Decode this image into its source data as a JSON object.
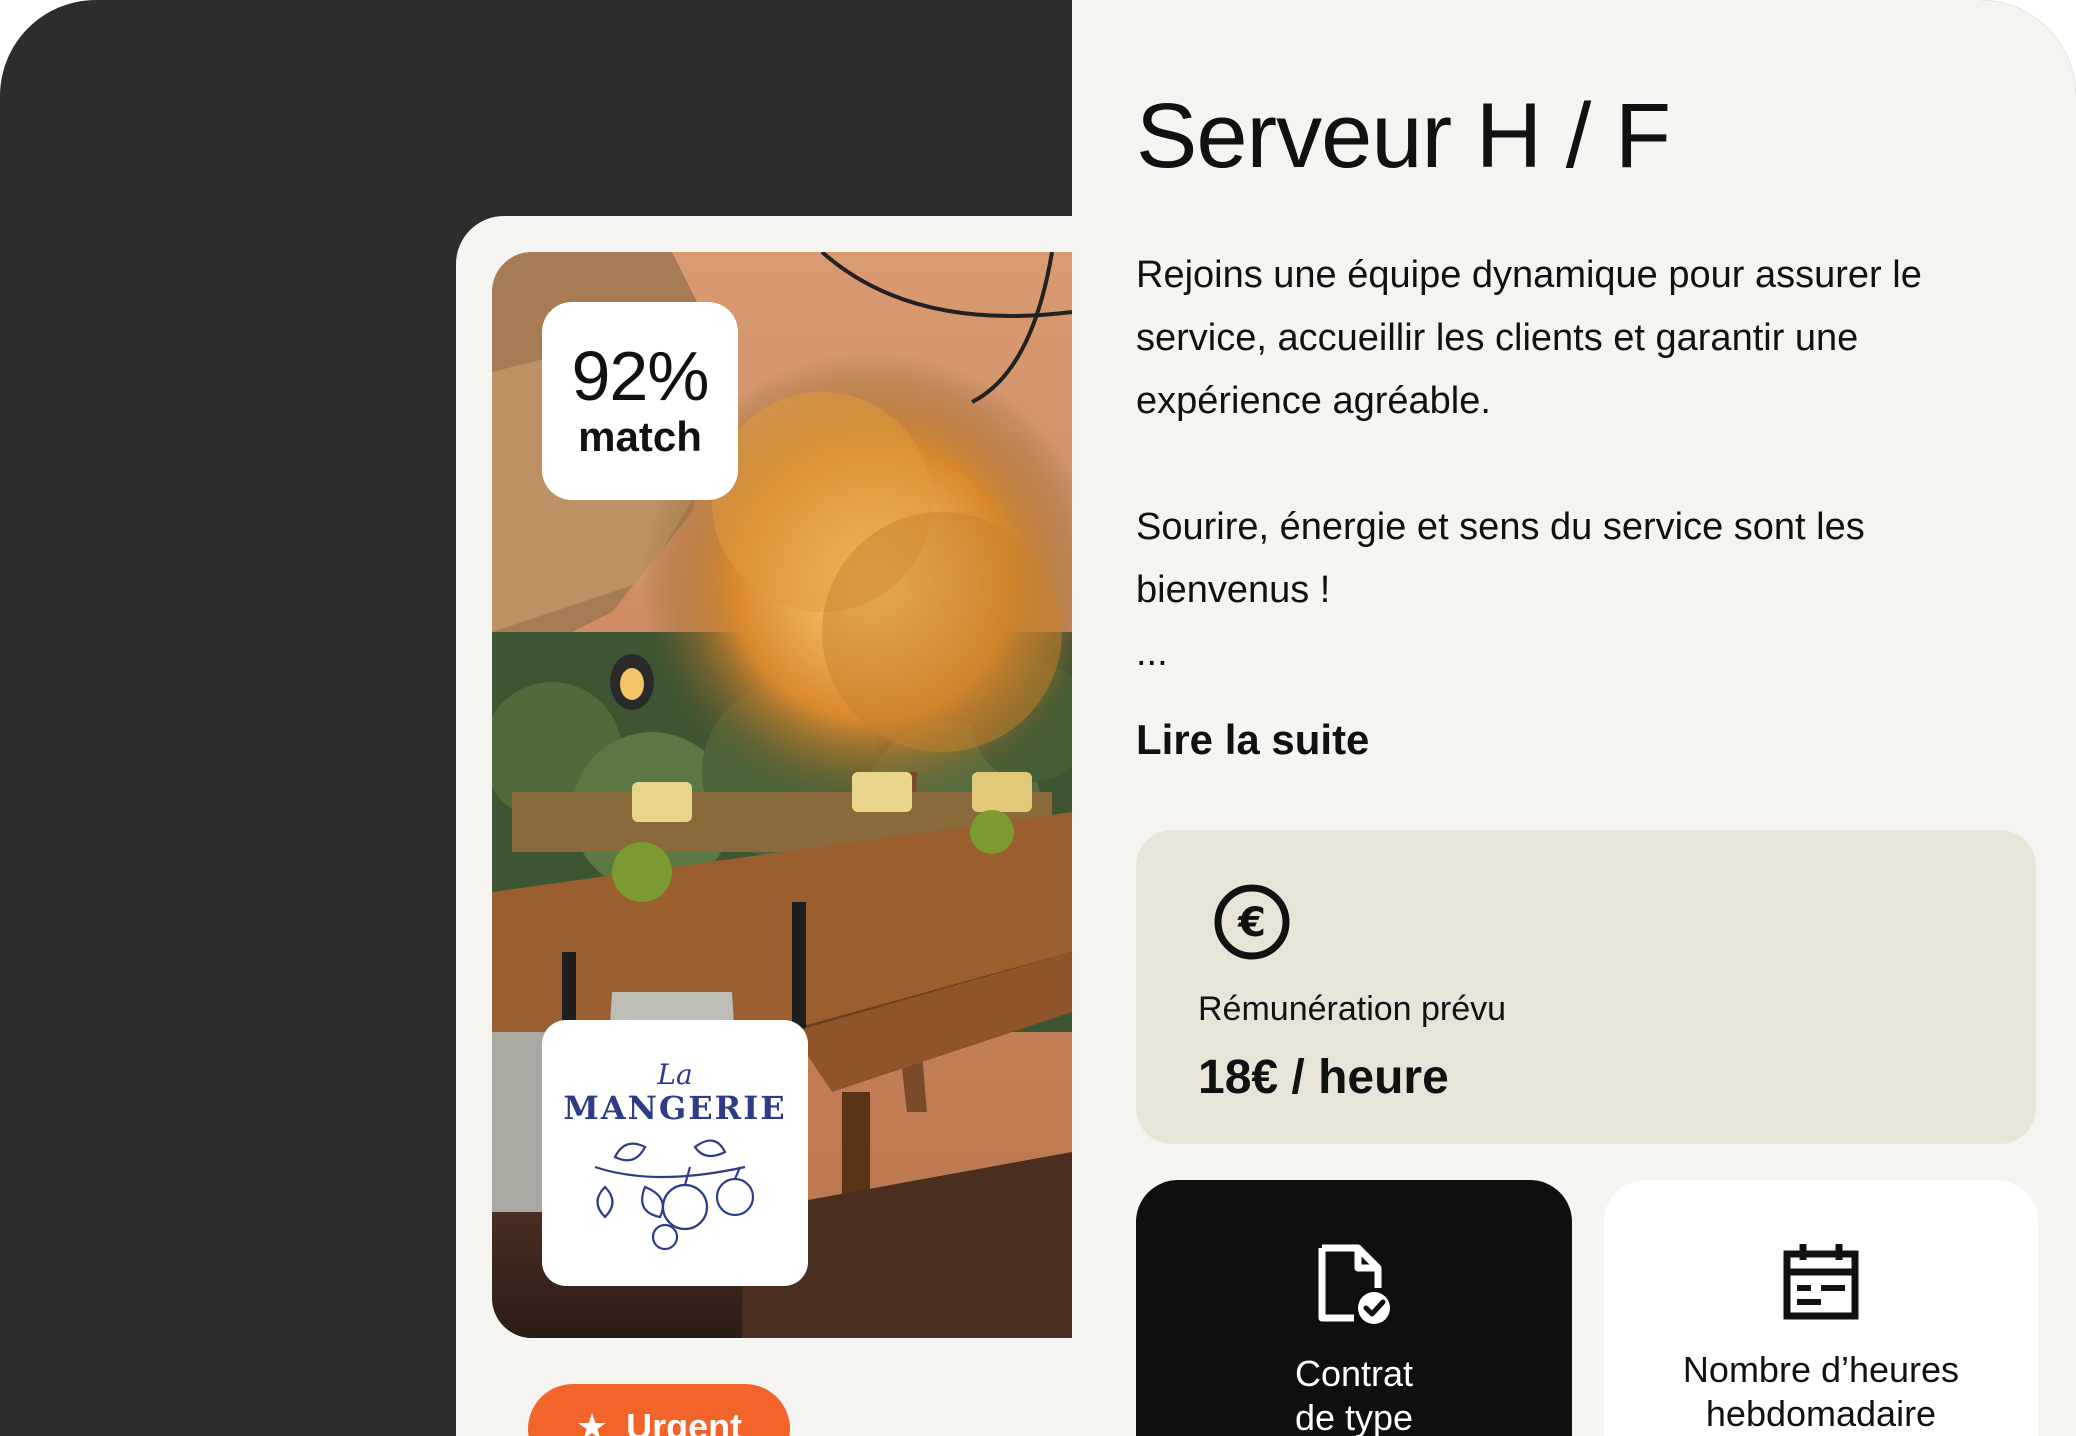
{
  "job": {
    "title": "Serveur H / F",
    "description": [
      "Rejoins une équipe dynamique pour assurer le service, accueillir les clients et garantir une expérience agréable.",
      "",
      "Sourire, énergie et sens du service sont les bienvenus !",
      "..."
    ],
    "read_more_label": "Lire la suite"
  },
  "card": {
    "match_percent": "92%",
    "match_label": "match",
    "logo": {
      "script": "La",
      "word": "MANGERIE"
    },
    "urgent_label": "Urgent",
    "urgent_icon": "star-icon"
  },
  "salary": {
    "icon": "euro-icon",
    "label": "Rémunération prévu",
    "value": "18€ / heure"
  },
  "tiles": [
    {
      "icon": "contract-icon",
      "label_line1": "Contrat",
      "label_line2": "de type"
    },
    {
      "icon": "calendar-icon",
      "label_line1": "Nombre d’heures",
      "label_line2": "hebdomadaire"
    }
  ],
  "colors": {
    "dark_background": "#2d2d2d",
    "panel_background": "#f5f4f1",
    "salary_background": "#e8e4d8",
    "urgent_orange": "#f2642a",
    "logo_blue": "#2f3b86"
  }
}
